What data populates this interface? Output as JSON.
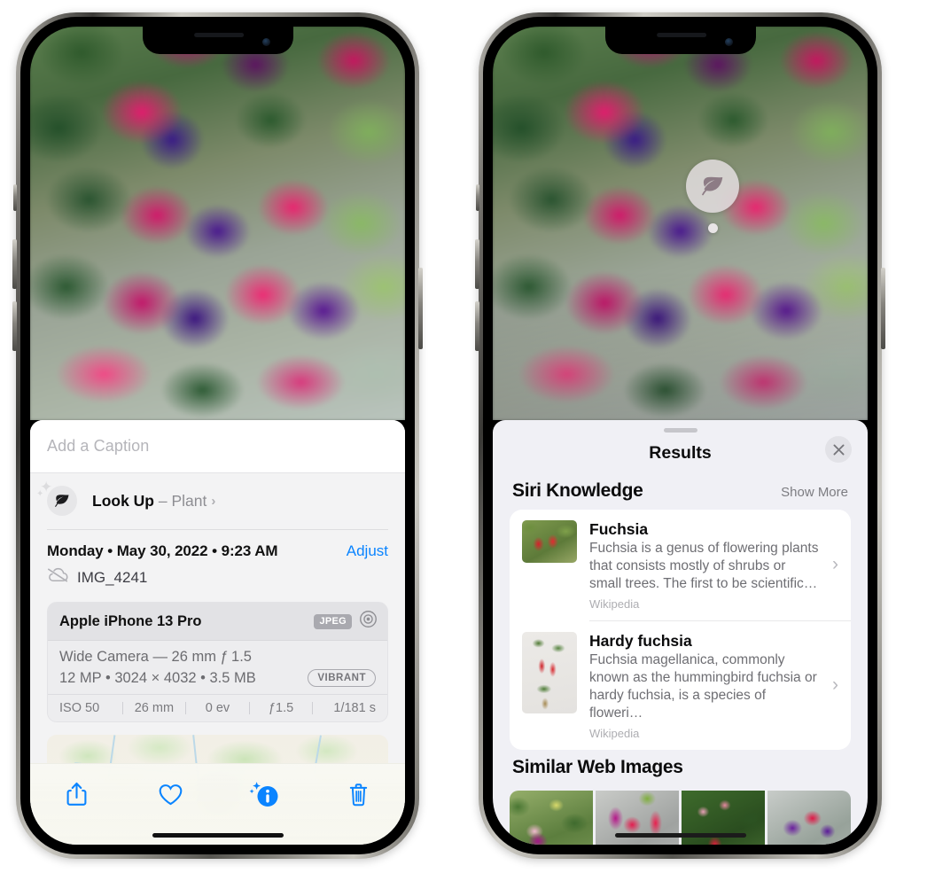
{
  "left_phone": {
    "caption_field": {
      "placeholder": "Add a Caption",
      "value": ""
    },
    "look_up": {
      "label": "Look Up",
      "dash": " – ",
      "subject": "Plant",
      "chevron": "›",
      "icon": "leaf-icon"
    },
    "metadata": {
      "date": "Monday • May 30, 2022 • 9:23 AM",
      "adjust_label": "Adjust",
      "filename": "IMG_4241",
      "cloud_icon": "cloud-slash-icon"
    },
    "exif": {
      "device": "Apple iPhone 13 Pro",
      "format_chip": "JPEG",
      "aperture_icon": "aperture-icon",
      "lens_line": "Wide Camera — 26 mm ƒ 1.5",
      "size_line": "12 MP • 3024 × 4032 • 3.5 MB",
      "style_chip": "VIBRANT",
      "stats": [
        "ISO 50",
        "26 mm",
        "0 ev",
        "ƒ1.5",
        "1/181 s"
      ]
    },
    "map": {
      "name": "location-map-thumbnail",
      "pin": "photo-pin"
    },
    "toolbar": [
      {
        "name": "share-button",
        "icon": "share-icon"
      },
      {
        "name": "favorite-button",
        "icon": "heart-icon"
      },
      {
        "name": "info-button",
        "icon": "info-sparkle-icon"
      },
      {
        "name": "delete-button",
        "icon": "trash-icon"
      }
    ],
    "accent": "#0a84ff"
  },
  "right_phone": {
    "badge": {
      "name": "visual-look-up-badge",
      "icon": "leaf-icon"
    },
    "sheet": {
      "title": "Results",
      "close_icon": "close-icon",
      "grabber": "sheet-grabber"
    },
    "siri_knowledge": {
      "heading": "Siri Knowledge",
      "action": "Show More",
      "items": [
        {
          "title": "Fuchsia",
          "description": "Fuchsia is a genus of flowering plants that consists mostly of shrubs or small trees. The first to be scientific…",
          "source": "Wikipedia",
          "thumb": "fuchsia-red-flower-thumb"
        },
        {
          "title": "Hardy fuchsia",
          "description": "Fuchsia magellanica, commonly known as the hummingbird fuchsia or hardy fuchsia, is a species of floweri…",
          "source": "Wikipedia",
          "thumb": "hardy-fuchsia-specimen-thumb"
        }
      ]
    },
    "similar_web_images": {
      "heading": "Similar Web Images",
      "thumbs": [
        "fuchsia-web-image-1",
        "fuchsia-web-image-2",
        "fuchsia-web-image-3",
        "fuchsia-web-image-4"
      ]
    }
  }
}
